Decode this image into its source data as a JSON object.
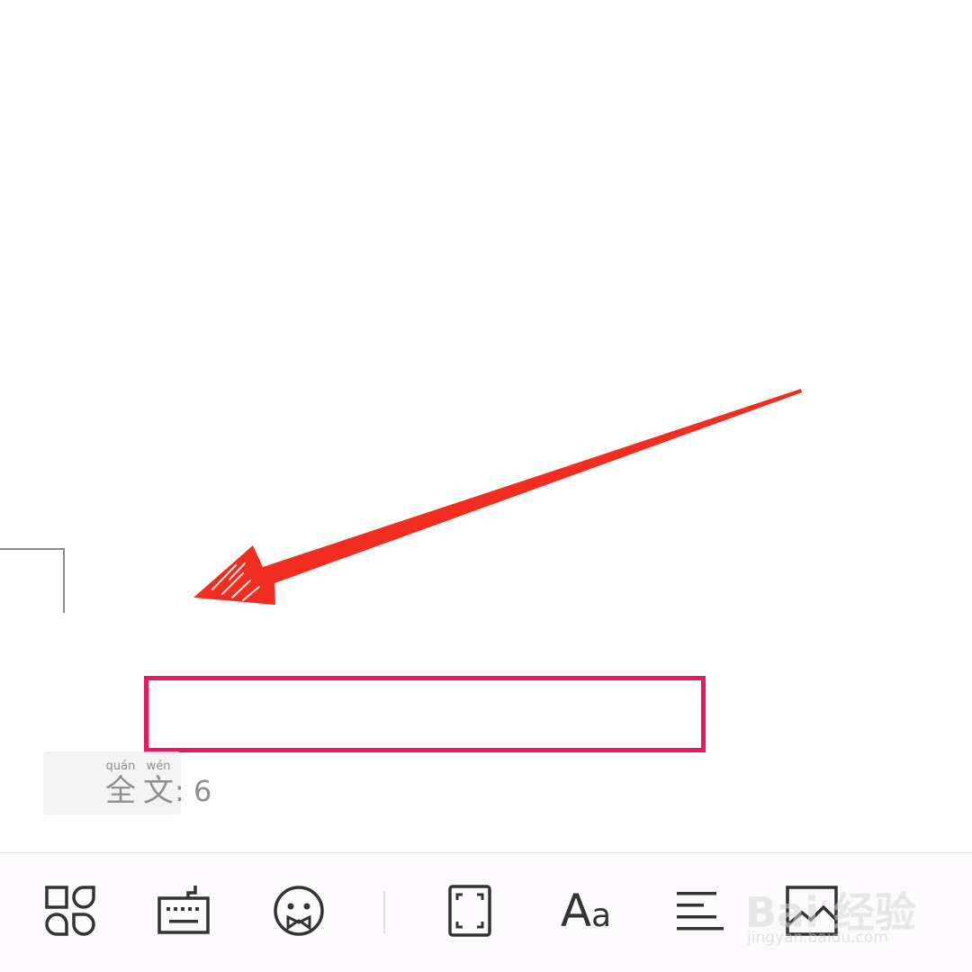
{
  "status": {
    "word_count_pinyin_1": "quán",
    "word_count_hanzi_1": "全",
    "word_count_pinyin_2": "wén",
    "word_count_hanzi_2": "文",
    "word_count_value": ": 6"
  },
  "toolbar": {
    "items": [
      {
        "name": "apps-grid-icon"
      },
      {
        "name": "keyboard-icon"
      },
      {
        "name": "emoji-icon"
      },
      {
        "name": "fullscreen-icon"
      },
      {
        "name": "font-size-icon",
        "label_big": "A",
        "label_small": "a"
      },
      {
        "name": "align-left-icon"
      },
      {
        "name": "image-icon"
      }
    ]
  },
  "annotations": {
    "arrow_color": "#f12d1f",
    "highlight_color": "#f0145a"
  },
  "watermark": {
    "logo": "Bai 经验",
    "url": "jingyan.baidu.com"
  }
}
